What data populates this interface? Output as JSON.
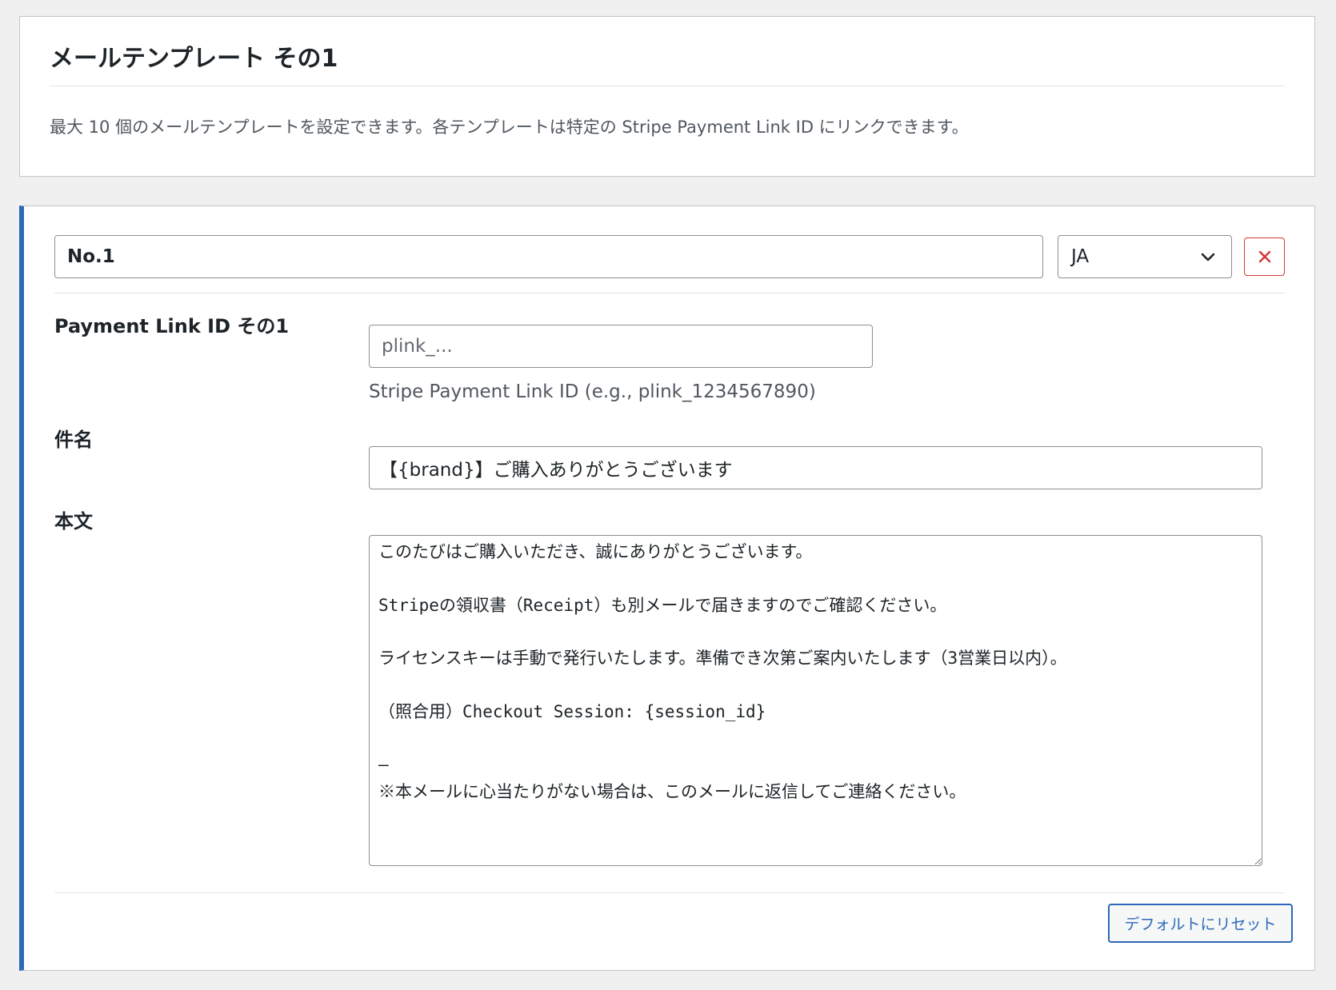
{
  "header": {
    "title": "メールテンプレート その1",
    "description": "最大 10 個のメールテンプレートを設定できます。各テンプレートは特定の Stripe Payment Link ID にリンクできます。"
  },
  "template": {
    "name_value": "No.1",
    "language": {
      "selected": "JA"
    },
    "remove_icon": "close-icon",
    "payment_link": {
      "label": "Payment Link ID その1",
      "placeholder": "plink_...",
      "value": "",
      "help": "Stripe Payment Link ID (e.g., plink_1234567890)"
    },
    "subject": {
      "label": "件名",
      "value": "【{brand}】ご購入ありがとうございます"
    },
    "body": {
      "label": "本文",
      "value": "このたびはご購入いただき、誠にありがとうございます。\n\nStripeの領収書（Receipt）も別メールで届きますのでご確認ください。\n\nライセンスキーは手動で発行いたします。準備でき次第ご案内いたします（3営業日以内）。\n\n（照合用）Checkout Session: {session_id}\n\n—\n※本メールに心当たりがない場合は、このメールに返信してご連絡ください。"
    },
    "reset_label": "デフォルトにリセット"
  },
  "colors": {
    "accent": "#2c6ab9",
    "danger": "#d63638"
  }
}
